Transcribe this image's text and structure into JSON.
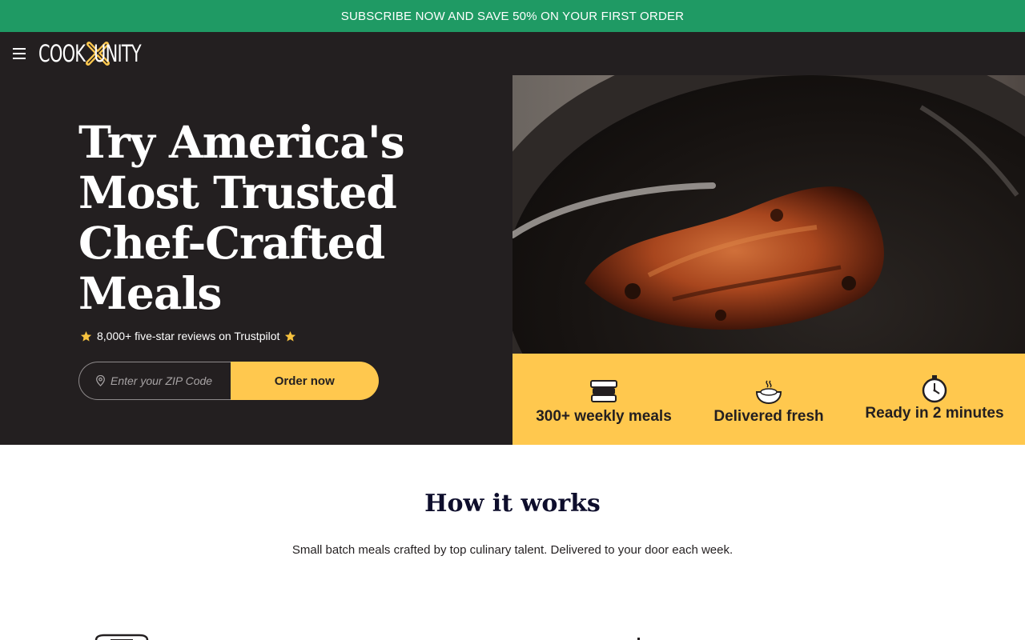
{
  "promo": {
    "text": "SUBSCRIBE NOW AND SAVE 50% ON YOUR FIRST ORDER"
  },
  "header": {
    "logo_left": "COOK",
    "logo_right": "UNITY"
  },
  "hero": {
    "title": "Try America's Most Trusted Chef-Crafted Meals",
    "reviews": "8,000+ five-star reviews on Trustpilot",
    "zip_placeholder": "Enter your ZIP Code",
    "order_button": "Order now"
  },
  "features": [
    {
      "label": "300+ weekly meals",
      "icon": "meal-containers-icon"
    },
    {
      "label": "Delivered fresh",
      "icon": "steaming-bowl-icon"
    },
    {
      "label": "Ready in 2 minutes",
      "icon": "stopwatch-icon"
    }
  ],
  "how_it_works": {
    "title": "How it works",
    "subtitle": "Small batch meals crafted by top culinary talent. Delivered to your door each week."
  },
  "colors": {
    "promo_green": "#1f9a64",
    "dark": "#231f20",
    "accent_yellow": "#ffc84e"
  }
}
